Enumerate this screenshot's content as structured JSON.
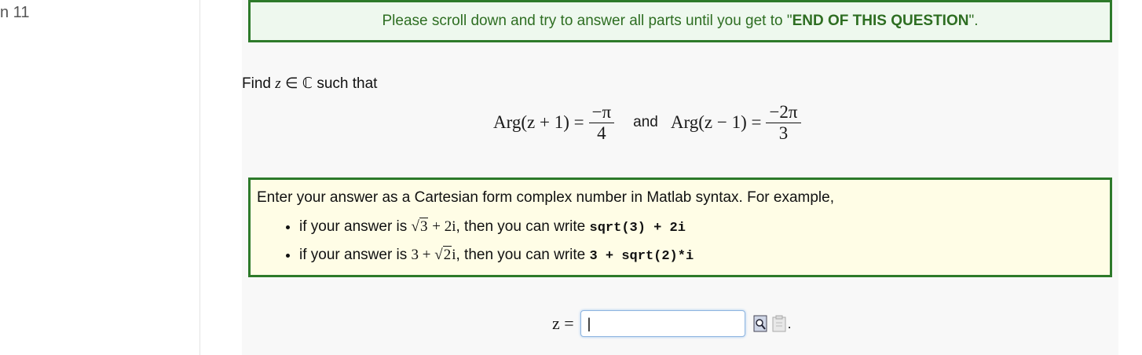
{
  "question_label": "n 11",
  "banner": {
    "prefix": "Please scroll down and try to answer all parts until you get to \"",
    "bold": "END OF THIS QUESTION",
    "suffix": "\"."
  },
  "prompt": {
    "find": "Find",
    "var": "z",
    "in": "∈",
    "set": "ℂ",
    "such_that": "such that"
  },
  "equation": {
    "lhs1": "Arg(z + 1) =",
    "frac1_num": "−π",
    "frac1_den": "4",
    "and": "and",
    "lhs2": "Arg(z − 1) =",
    "frac2_num": "−2π",
    "frac2_den": "3"
  },
  "instructions": {
    "intro": "Enter your answer as a Cartesian form complex number in Matlab syntax. For example,",
    "examples": [
      {
        "prefix": "if your answer is ",
        "math_a": "",
        "radicand": "3",
        "math_b": " + 2i",
        "middle": ", then you can write ",
        "code": "sqrt(3) + 2i"
      },
      {
        "prefix": "if your answer is ",
        "math_a": "3 + ",
        "radicand": "2",
        "math_b": "i",
        "middle": ", then you can write ",
        "code": "3 + sqrt(2)*i"
      }
    ]
  },
  "answer": {
    "label": "z =",
    "value": "|",
    "trailing": "."
  },
  "icons": [
    "preview-icon",
    "paste-icon"
  ],
  "colors": {
    "banner_border": "#2d7a2a",
    "banner_bg": "#eef8ee",
    "instr_bg": "#fffde6",
    "input_border": "#8fb5e0"
  }
}
